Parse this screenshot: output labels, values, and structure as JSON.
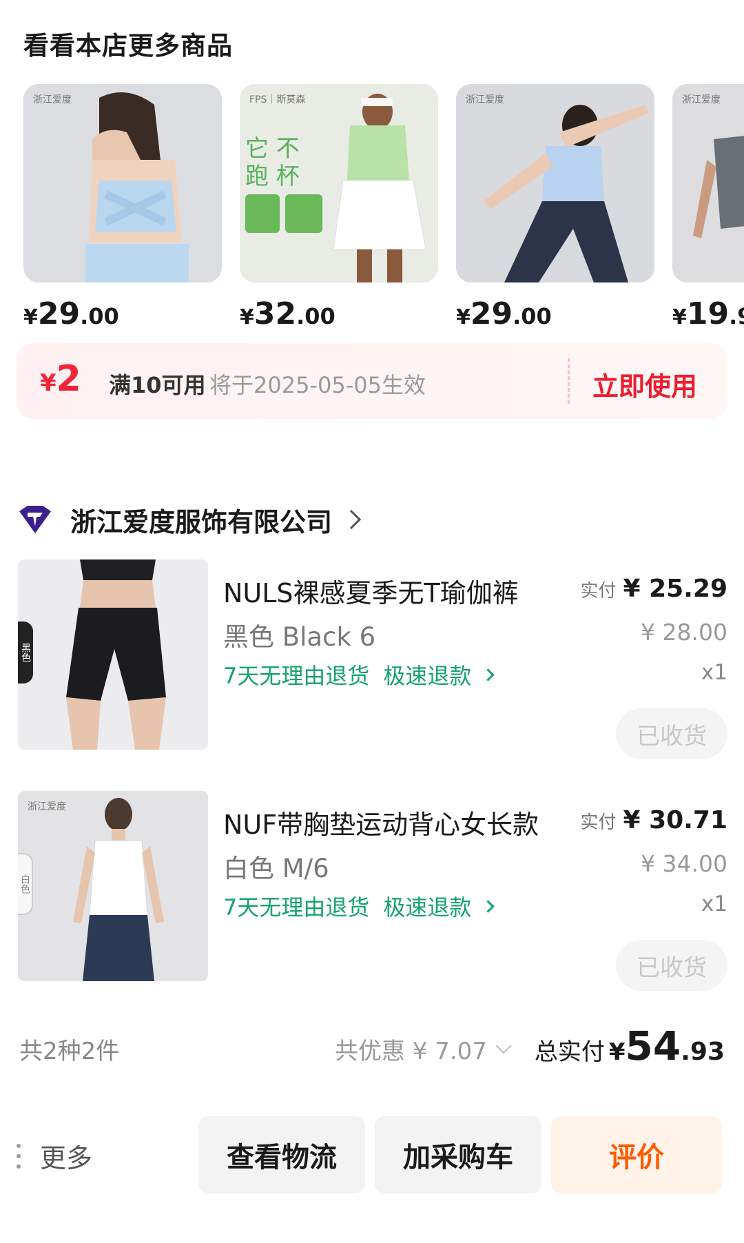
{
  "recommend": {
    "title": "看看本店更多商品",
    "items": [
      {
        "brand": "浙江爱度",
        "currency": "¥",
        "price_int": "29",
        "price_dec": ".00"
      },
      {
        "brand": "FPS｜斯莫森",
        "currency": "¥",
        "price_int": "32",
        "price_dec": ".00"
      },
      {
        "brand": "浙江爱度",
        "currency": "¥",
        "price_int": "29",
        "price_dec": ".00"
      },
      {
        "brand": "浙江爱度",
        "currency": "¥",
        "price_int": "19",
        "price_dec": ".9"
      }
    ]
  },
  "coupon": {
    "currency": "¥",
    "amount": "2",
    "condition": "满10可用",
    "effective": "将于2025-05-05生效",
    "action": "立即使用"
  },
  "shop": {
    "name": "浙江爱度服饰有限公司"
  },
  "items": [
    {
      "title": "NULS裸感夏季无T瑜伽裤",
      "spec": "黑色 Black 6",
      "service_return": "7天无理由退货",
      "service_refund": "极速退款",
      "paid_label": "实付",
      "paid": "¥ 25.29",
      "original": "¥ 28.00",
      "qty": "x1",
      "status": "已收货",
      "color_tab": "黑色"
    },
    {
      "title": "NUF带胸垫运动背心女长款",
      "spec": "白色 M/6",
      "service_return": "7天无理由退货",
      "service_refund": "极速退款",
      "paid_label": "实付",
      "paid": "¥ 30.71",
      "original": "¥ 34.00",
      "qty": "x1",
      "status": "已收货",
      "color_tab": "白色",
      "brand": "浙江爱度"
    }
  ],
  "summary": {
    "count": "共2种2件",
    "discount": "共优惠 ¥ 7.07",
    "total_label": "总实付",
    "currency": "¥",
    "total_int": "54",
    "total_dec": ".93"
  },
  "actions": {
    "more": "更多",
    "logistics": "查看物流",
    "cart": "加采购车",
    "review": "评价"
  },
  "colors": {
    "accent_red": "#ee1c2e",
    "service_green": "#13a36b",
    "review_orange": "#ff5a00"
  }
}
